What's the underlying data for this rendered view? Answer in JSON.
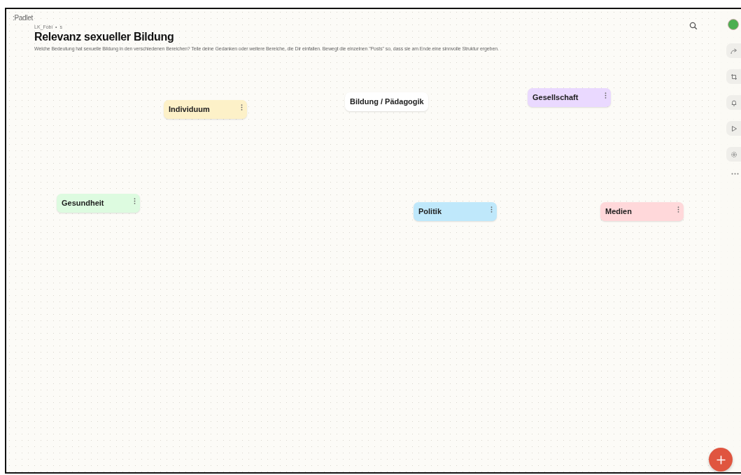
{
  "app": {
    "logo": ":Padlet"
  },
  "header": {
    "author": "LK_Fobi",
    "separator": "•",
    "suffix": "s",
    "title": "Relevanz sexueller Bildung",
    "description": "Welche Bedeutung hat sexuelle Bildung in den verschiedenen Bereichen? Teile deine Gedanken oder weitere Bereiche, die Dir einfallen. Bewegt die einzelnen \"Posts\" so, dass sie am Ende eine sinnvolle Struktur ergeben."
  },
  "posts": [
    {
      "title": "Individuum",
      "color": "#fdf1c8"
    },
    {
      "title": "Bildung / Pädagogik",
      "color": "#ffffff"
    },
    {
      "title": "Gesellschaft",
      "color": "#ead9ff"
    },
    {
      "title": "Gesundheit",
      "color": "#ddfbe0"
    },
    {
      "title": "Politik",
      "color": "#bfe8fb"
    },
    {
      "title": "Medien",
      "color": "#ffd8da"
    }
  ]
}
